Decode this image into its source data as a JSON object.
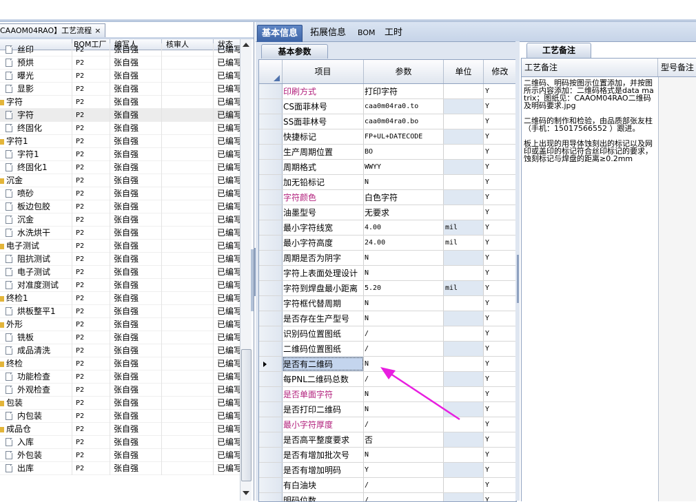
{
  "left_panel": {
    "tab_label": "CAAOM04RAO】工艺流程",
    "tab_close": "×",
    "columns": [
      "",
      "BOM工厂",
      "编写人",
      "核审人",
      "状态"
    ],
    "rows": [
      {
        "name": "丝印",
        "level": 1,
        "bom": "P2",
        "writer": "张自强",
        "status": "已编写"
      },
      {
        "name": "预烘",
        "level": 1,
        "bom": "P2",
        "writer": "张自强",
        "status": "已编写"
      },
      {
        "name": "曝光",
        "level": 1,
        "bom": "P2",
        "writer": "张自强",
        "status": "已编写"
      },
      {
        "name": "显影",
        "level": 1,
        "bom": "P2",
        "writer": "张自强",
        "status": "已编写"
      },
      {
        "name": "字符",
        "level": 0,
        "bom": "P2",
        "writer": "张自强",
        "status": "已编写"
      },
      {
        "name": "字符",
        "level": 1,
        "bom": "P2",
        "writer": "张自强",
        "status": "已编写",
        "selected": true
      },
      {
        "name": "终固化",
        "level": 1,
        "bom": "P2",
        "writer": "张自强",
        "status": "已编写"
      },
      {
        "name": "字符1",
        "level": 0,
        "bom": "P2",
        "writer": "张自强",
        "status": "已编写"
      },
      {
        "name": "字符1",
        "level": 1,
        "bom": "P2",
        "writer": "张自强",
        "status": "已编写"
      },
      {
        "name": "终固化1",
        "level": 1,
        "bom": "P2",
        "writer": "张自强",
        "status": "已编写"
      },
      {
        "name": "沉金",
        "level": 0,
        "bom": "P2",
        "writer": "张自强",
        "status": "已编写"
      },
      {
        "name": "喷砂",
        "level": 1,
        "bom": "P2",
        "writer": "张自强",
        "status": "已编写"
      },
      {
        "name": "板边包胶",
        "level": 1,
        "bom": "P2",
        "writer": "张自强",
        "status": "已编写"
      },
      {
        "name": "沉金",
        "level": 1,
        "bom": "P2",
        "writer": "张自强",
        "status": "已编写"
      },
      {
        "name": "水洗烘干",
        "level": 1,
        "bom": "P2",
        "writer": "张自强",
        "status": "已编写"
      },
      {
        "name": "电子测试",
        "level": 0,
        "bom": "P2",
        "writer": "张自强",
        "status": "已编写"
      },
      {
        "name": "阻抗测试",
        "level": 1,
        "bom": "P2",
        "writer": "张自强",
        "status": "已编写"
      },
      {
        "name": "电子测试",
        "level": 1,
        "bom": "P2",
        "writer": "张自强",
        "status": "已编写"
      },
      {
        "name": "对准度测试",
        "level": 1,
        "bom": "P2",
        "writer": "张自强",
        "status": "已编写"
      },
      {
        "name": "终检1",
        "level": 0,
        "bom": "P2",
        "writer": "张自强",
        "status": "已编写"
      },
      {
        "name": "烘板整平1",
        "level": 1,
        "bom": "P2",
        "writer": "张自强",
        "status": "已编写"
      },
      {
        "name": "外形",
        "level": 0,
        "bom": "P2",
        "writer": "张自强",
        "status": "已编写"
      },
      {
        "name": "铣板",
        "level": 1,
        "bom": "P2",
        "writer": "张自强",
        "status": "已编写"
      },
      {
        "name": "成品清洗",
        "level": 1,
        "bom": "P2",
        "writer": "张自强",
        "status": "已编写"
      },
      {
        "name": "终检",
        "level": 0,
        "bom": "P2",
        "writer": "张自强",
        "status": "已编写"
      },
      {
        "name": "功能检查",
        "level": 1,
        "bom": "P2",
        "writer": "张自强",
        "status": "已编写"
      },
      {
        "name": "外观检查",
        "level": 1,
        "bom": "P2",
        "writer": "张自强",
        "status": "已编写"
      },
      {
        "name": "包装",
        "level": 0,
        "bom": "P2",
        "writer": "张自强",
        "status": "已编写"
      },
      {
        "name": "内包装",
        "level": 1,
        "bom": "P2",
        "writer": "张自强",
        "status": "已编写"
      },
      {
        "name": "成品仓",
        "level": 0,
        "bom": "P2",
        "writer": "张自强",
        "status": "已编写"
      },
      {
        "name": "入库",
        "level": 1,
        "bom": "P2",
        "writer": "张自强",
        "status": "已编写"
      },
      {
        "name": "外包装",
        "level": 1,
        "bom": "P2",
        "writer": "张自强",
        "status": "已编写"
      },
      {
        "name": "出库",
        "level": 1,
        "bom": "P2",
        "writer": "张自强",
        "status": "已编写"
      }
    ]
  },
  "main_tabs": [
    {
      "label": "基本信息",
      "active": true
    },
    {
      "label": "拓展信息",
      "active": false
    },
    {
      "label": "BOM",
      "active": false
    },
    {
      "label": "工时",
      "active": false
    }
  ],
  "basic_params": {
    "sub_tab": "基本参数",
    "columns": [
      "项目",
      "参数",
      "单位",
      "修改"
    ],
    "rows": [
      {
        "item": "印刷方式",
        "param": "打印字符",
        "unit": "",
        "mod": "Y",
        "pink": true
      },
      {
        "item": "CS面菲林号",
        "param": "caa0m04ra0.to",
        "unit": "",
        "mod": "Y"
      },
      {
        "item": "SS面菲林号",
        "param": "caa0m04ra0.bo",
        "unit": "",
        "mod": "Y"
      },
      {
        "item": "快捷标记",
        "param": "FP+UL+DATECODE",
        "unit": "",
        "mod": "Y"
      },
      {
        "item": "生产周期位置",
        "param": "BO",
        "unit": "",
        "mod": "Y"
      },
      {
        "item": "周期格式",
        "param": "WWYY",
        "unit": "",
        "mod": "Y"
      },
      {
        "item": "加无铅标记",
        "param": "N",
        "unit": "",
        "mod": "Y"
      },
      {
        "item": "字符颜色",
        "param": "白色字符",
        "unit": "",
        "mod": "Y",
        "pink": true
      },
      {
        "item": "油墨型号",
        "param": "无要求",
        "unit": "",
        "mod": "Y"
      },
      {
        "item": "最小字符线宽",
        "param": "4.00",
        "unit": "mil",
        "mod": "Y"
      },
      {
        "item": "最小字符高度",
        "param": "24.00",
        "unit": "mil",
        "mod": "Y"
      },
      {
        "item": "周期是否为阴字",
        "param": "N",
        "unit": "",
        "mod": "Y"
      },
      {
        "item": "字符上表面处理设计",
        "param": "N",
        "unit": "",
        "mod": "Y"
      },
      {
        "item": "字符到焊盘最小距离",
        "param": "5.20",
        "unit": "mil",
        "mod": "Y"
      },
      {
        "item": "字符框代替周期",
        "param": "N",
        "unit": "",
        "mod": "Y"
      },
      {
        "item": "是否存在生产型号",
        "param": "N",
        "unit": "",
        "mod": "Y"
      },
      {
        "item": "识别码位置图纸",
        "param": "/",
        "unit": "",
        "mod": "Y"
      },
      {
        "item": "二维码位置图纸",
        "param": "/",
        "unit": "",
        "mod": "Y"
      },
      {
        "item": "是否有二维码",
        "param": "N",
        "unit": "",
        "mod": "Y",
        "selected": true
      },
      {
        "item": "每PNL二维码总数",
        "param": "/",
        "unit": "",
        "mod": "Y"
      },
      {
        "item": "是否单面字符",
        "param": "N",
        "unit": "",
        "mod": "Y",
        "pink": true
      },
      {
        "item": "是否打印二维码",
        "param": "N",
        "unit": "",
        "mod": "Y"
      },
      {
        "item": "最小字符厚度",
        "param": "/",
        "unit": "",
        "mod": "Y",
        "pink": true
      },
      {
        "item": "是否高平整度要求",
        "param": "否",
        "unit": "",
        "mod": "Y"
      },
      {
        "item": "是否有增加批次号",
        "param": "N",
        "unit": "",
        "mod": "Y"
      },
      {
        "item": "是否有增加明码",
        "param": "Y",
        "unit": "",
        "mod": "Y"
      },
      {
        "item": "有白油块",
        "param": "/",
        "unit": "",
        "mod": "Y"
      },
      {
        "item": "明码位数",
        "param": "/",
        "unit": "",
        "mod": "Y"
      }
    ]
  },
  "craft_notes": {
    "tab_label": "工艺备注",
    "col1": "工艺备注",
    "col2": "型号备注",
    "note": "二维码、明码按图示位置添加，并按图所示内容添加：二维码格式是data matrix；图纸见：CAAOM04RAO二维码及明码要求.jpg\n\n二维码的制作和检验，由品质部张友柱（手机：15017566552 ）跟进。\n\n板上出现的用导体蚀刻出的标记以及网印或盖印的标记符合丝印标记的要求，蚀刻标记与焊盘的距离≥0.2mm"
  },
  "colors": {
    "accent_tab": "#3d65a8",
    "pink_label": "#b2207c",
    "annotation_arrow": "#e81ee0",
    "selection": "#c4d5ee"
  }
}
